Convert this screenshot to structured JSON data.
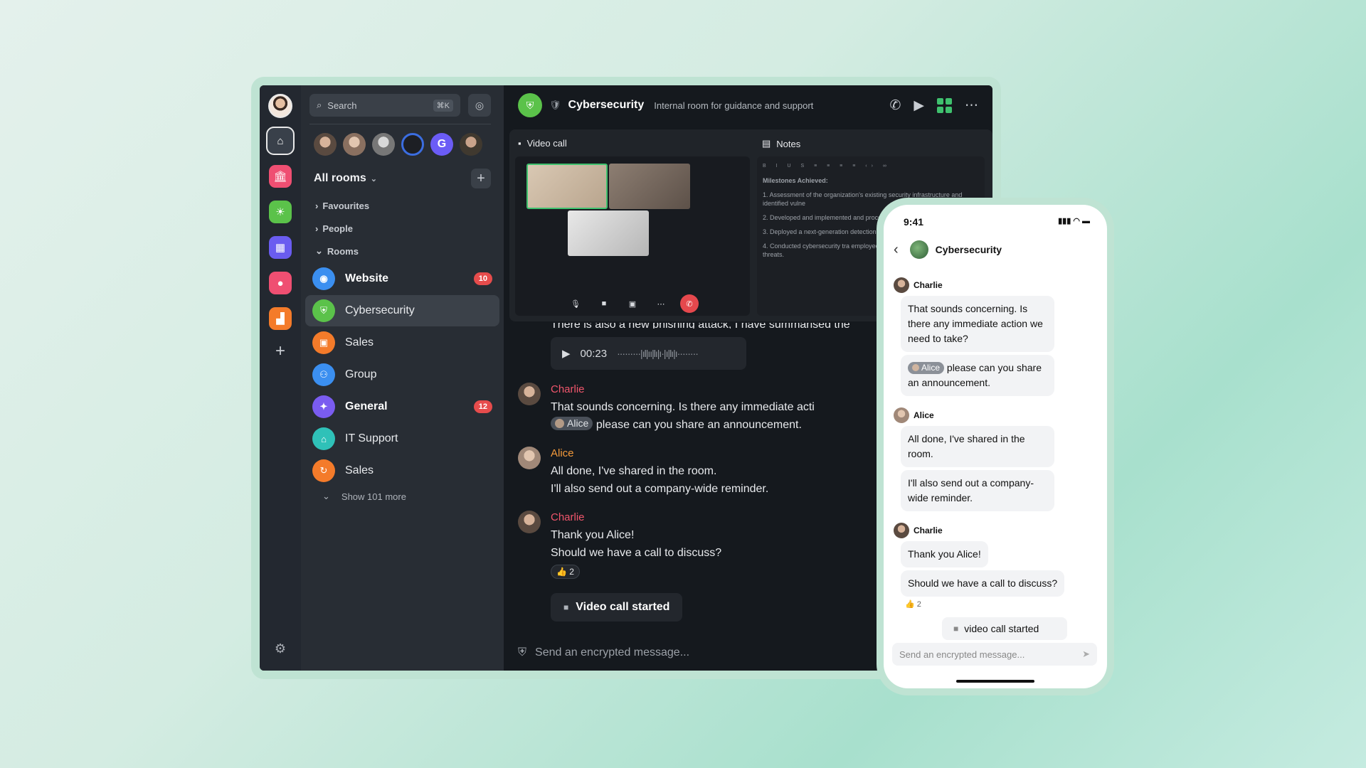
{
  "search": {
    "placeholder": "Search",
    "shortcut": "⌘K"
  },
  "rail": {
    "spaces": [
      {
        "icon": "home-icon",
        "color": "#39404a"
      },
      {
        "icon": "bank-icon",
        "color": "#ef4f72"
      },
      {
        "icon": "sun-icon",
        "color": "#5bc24a"
      },
      {
        "icon": "calendar-icon",
        "color": "#6a5cf0"
      },
      {
        "icon": "pin-icon",
        "color": "#ef4f72"
      },
      {
        "icon": "chart-icon",
        "color": "#f47b2a"
      }
    ]
  },
  "people_avatars": [
    {
      "initial": "",
      "color": "#7a6a5e"
    },
    {
      "initial": "",
      "color": "#c8b4a4"
    },
    {
      "initial": "",
      "color": "#9a9a9a"
    },
    {
      "initial": "",
      "color": "#1d1f24"
    },
    {
      "initial": "G",
      "color": "#6b5cf6"
    },
    {
      "initial": "",
      "color": "#40392f"
    }
  ],
  "roomlist": {
    "header": "All rooms",
    "sections": {
      "favourites": "Favourites",
      "people": "People",
      "rooms": "Rooms"
    },
    "rooms": [
      {
        "name": "Website",
        "color": "#3b8ff0",
        "badge": "10",
        "bold": true
      },
      {
        "name": "Cybersecurity",
        "color": "#5bc24a",
        "badge": "",
        "active": true
      },
      {
        "name": "Sales",
        "color": "#f47b2a",
        "badge": ""
      },
      {
        "name": "Group",
        "color": "#3b8ff0",
        "badge": ""
      },
      {
        "name": "General",
        "color": "#7a5cf0",
        "badge": "12",
        "bold": true
      },
      {
        "name": "IT Support",
        "color": "#2fc1b8",
        "badge": ""
      },
      {
        "name": "Sales",
        "color": "#f47b2a",
        "badge": ""
      }
    ],
    "show_more": "Show 101 more"
  },
  "room": {
    "title": "Cybersecurity",
    "topic": "Internal room for guidance and support"
  },
  "widgets": {
    "video_label": "Video call",
    "notes_label": "Notes",
    "notes_heading": "Milestones Achieved:",
    "notes_items": [
      "1. Assessment of the organization's existing security infrastructure and identified vulne",
      "2. Developed and implemented and procedures, aligning them",
      "3. Deployed a next-generation detection system to fortify our",
      "4. Conducted cybersecurity tra employees, focusing on recogn security threats."
    ]
  },
  "timeline": {
    "partial_text": "There is also a new phishing attack, I have summarised the",
    "voice_duration": "00:23",
    "messages": [
      {
        "sender": "Charlie",
        "color": "#f0566c",
        "lines": [
          "That sounds concerning. Is there any immediate action we nee"
        ],
        "mention": "Alice",
        "mention_tail": "please can you share an announcement."
      },
      {
        "sender": "Alice",
        "color": "#f49a3b",
        "lines": [
          "All done, I've shared in the room.",
          "I'll also send out a company-wide reminder."
        ]
      },
      {
        "sender": "Charlie",
        "color": "#f0566c",
        "lines": [
          "Thank you Alice!",
          "Should we have a call to discuss?"
        ],
        "reaction": "👍 2"
      }
    ],
    "video_call_started": "Video call started",
    "composer_placeholder": "Send an encrypted message..."
  },
  "phone": {
    "time": "9:41",
    "room_title": "Cybersecurity",
    "charlie": "Charlie",
    "alice": "Alice",
    "msg1": "That sounds concerning. Is there any immediate action we need to take?",
    "mention": "Alice",
    "msg1b": "please can you share an announcement.",
    "msg2": "All done, I've shared in the room.",
    "msg2b": "I'll also send out a company-wide reminder.",
    "msg3": "Thank you Alice!",
    "msg3b": "Should we have a call to discuss?",
    "reaction": "👍 2",
    "video_call_started": "video call started",
    "composer_placeholder": "Send an encrypted message..."
  }
}
